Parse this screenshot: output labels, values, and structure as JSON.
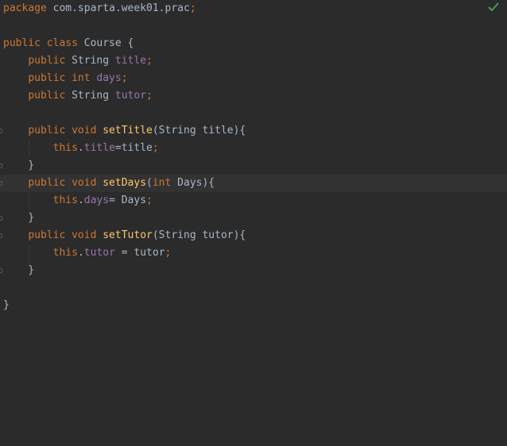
{
  "editor": {
    "status_ok_icon": "checkmark-icon",
    "colors": {
      "background": "#2b2b2b",
      "keyword": "#cc7832",
      "text": "#a9b7c6",
      "field": "#9876aa",
      "method": "#ffc66d",
      "status_ok": "#499c54"
    },
    "lines": [
      {
        "tokens": [
          {
            "t": "kw",
            "v": "package"
          },
          {
            "t": "plain",
            "v": " com.sparta.week01.prac"
          },
          {
            "t": "punct",
            "v": ";"
          }
        ]
      },
      {
        "tokens": []
      },
      {
        "tokens": [
          {
            "t": "kw",
            "v": "public class "
          },
          {
            "t": "plain",
            "v": "Course {"
          }
        ]
      },
      {
        "tokens": [
          {
            "t": "plain",
            "v": "    "
          },
          {
            "t": "kw",
            "v": "public "
          },
          {
            "t": "plain",
            "v": "String "
          },
          {
            "t": "field",
            "v": "title"
          },
          {
            "t": "punct",
            "v": ";"
          }
        ]
      },
      {
        "tokens": [
          {
            "t": "plain",
            "v": "    "
          },
          {
            "t": "kw",
            "v": "public int "
          },
          {
            "t": "field",
            "v": "days"
          },
          {
            "t": "punct",
            "v": ";"
          }
        ]
      },
      {
        "tokens": [
          {
            "t": "plain",
            "v": "    "
          },
          {
            "t": "kw",
            "v": "public "
          },
          {
            "t": "plain",
            "v": "String "
          },
          {
            "t": "field",
            "v": "tutor"
          },
          {
            "t": "punct",
            "v": ";"
          }
        ]
      },
      {
        "tokens": []
      },
      {
        "tokens": [
          {
            "t": "plain",
            "v": "    "
          },
          {
            "t": "kw",
            "v": "public void "
          },
          {
            "t": "method",
            "v": "setTitle"
          },
          {
            "t": "plain",
            "v": "(String title){"
          }
        ]
      },
      {
        "tokens": [
          {
            "t": "plain",
            "v": "        "
          },
          {
            "t": "kw",
            "v": "this"
          },
          {
            "t": "plain",
            "v": "."
          },
          {
            "t": "field",
            "v": "title"
          },
          {
            "t": "plain",
            "v": "=title"
          },
          {
            "t": "punct",
            "v": ";"
          }
        ]
      },
      {
        "tokens": [
          {
            "t": "plain",
            "v": "    }"
          }
        ]
      },
      {
        "tokens": [
          {
            "t": "plain",
            "v": "    "
          },
          {
            "t": "kw",
            "v": "public void "
          },
          {
            "t": "method",
            "v": "setDays"
          },
          {
            "t": "plain",
            "v": "("
          },
          {
            "t": "kw",
            "v": "int "
          },
          {
            "t": "plain",
            "v": "Days){"
          }
        ]
      },
      {
        "tokens": [
          {
            "t": "plain",
            "v": "        "
          },
          {
            "t": "kw",
            "v": "this"
          },
          {
            "t": "plain",
            "v": "."
          },
          {
            "t": "field",
            "v": "days"
          },
          {
            "t": "plain",
            "v": "= Days"
          },
          {
            "t": "punct",
            "v": ";"
          }
        ]
      },
      {
        "tokens": [
          {
            "t": "plain",
            "v": "    }"
          }
        ]
      },
      {
        "tokens": [
          {
            "t": "plain",
            "v": "    "
          },
          {
            "t": "kw",
            "v": "public void "
          },
          {
            "t": "method",
            "v": "setTutor"
          },
          {
            "t": "plain",
            "v": "(String tutor){"
          }
        ]
      },
      {
        "tokens": [
          {
            "t": "plain",
            "v": "        "
          },
          {
            "t": "kw",
            "v": "this"
          },
          {
            "t": "plain",
            "v": "."
          },
          {
            "t": "field",
            "v": "tutor"
          },
          {
            "t": "plain",
            "v": " = tutor"
          },
          {
            "t": "punct",
            "v": ";"
          }
        ]
      },
      {
        "tokens": [
          {
            "t": "plain",
            "v": "    }"
          }
        ]
      },
      {
        "tokens": []
      },
      {
        "tokens": [
          {
            "t": "plain",
            "v": "}"
          }
        ]
      }
    ]
  }
}
